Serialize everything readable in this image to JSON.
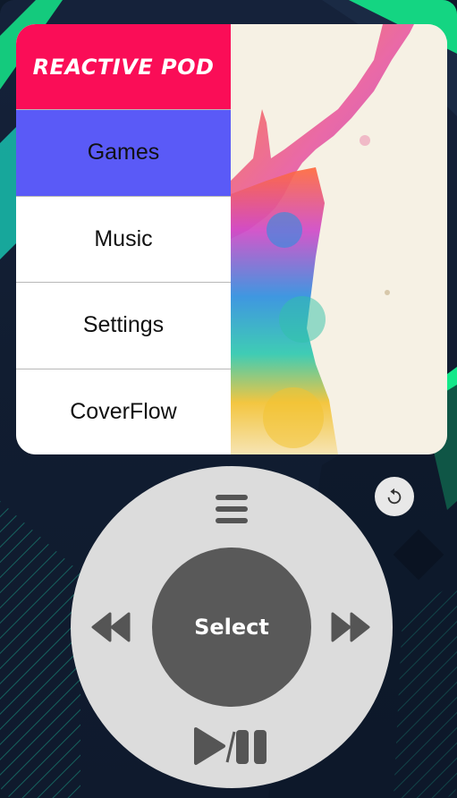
{
  "app": {
    "title": "REACTIVE POD"
  },
  "menu": {
    "items": [
      {
        "label": "Games",
        "active": true
      },
      {
        "label": "Music",
        "active": false
      },
      {
        "label": "Settings",
        "active": false
      },
      {
        "label": "CoverFlow",
        "active": false
      }
    ]
  },
  "wheel": {
    "select_label": "Select",
    "menu_icon": "menu-icon",
    "prev_icon": "rewind-icon",
    "next_icon": "fast-forward-icon",
    "play_icon": "play-pause-icon"
  },
  "reset": {
    "icon": "undo-icon"
  },
  "colors": {
    "title_bg": "#fa0d57",
    "active_item": "#5a5af7",
    "accent_green": "#14e88a",
    "wheel": "#dcdcdc",
    "select": "#595959"
  }
}
